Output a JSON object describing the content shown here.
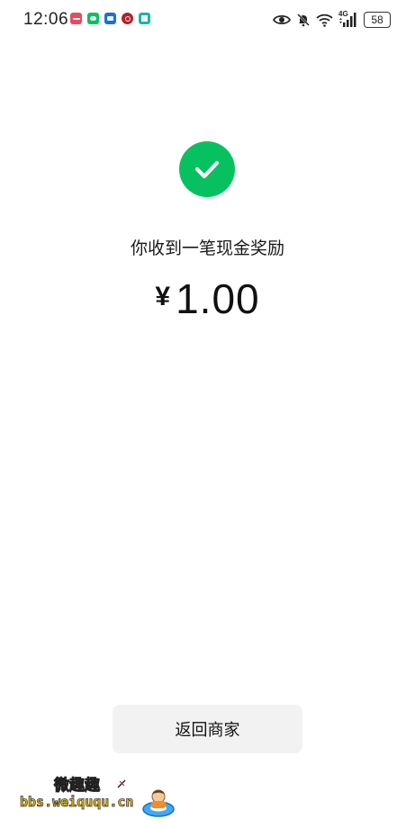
{
  "status_bar": {
    "time": "12:06",
    "network": "4G",
    "battery": "58",
    "notification_icons": [
      {
        "name": "app-red-icon",
        "color": "#e84a5f"
      },
      {
        "name": "wechat-icon",
        "color": "#07c160"
      },
      {
        "name": "message-icon",
        "color": "#1f6fd1"
      },
      {
        "name": "app-darkred-icon",
        "color": "#b3222a"
      },
      {
        "name": "app-teal-icon",
        "color": "#19b6a4"
      }
    ],
    "system_icons": [
      "eye-icon",
      "mute-icon",
      "wifi-icon",
      "signal-icon",
      "battery-icon"
    ]
  },
  "result": {
    "title": "你收到一笔现金奖励",
    "currency": "¥",
    "amount": "1.00",
    "accent_color": "#07c160"
  },
  "actions": {
    "return_label": "返回商家"
  },
  "watermark": {
    "name": "微趣趣",
    "url": "bbs.weiququ.cn"
  }
}
